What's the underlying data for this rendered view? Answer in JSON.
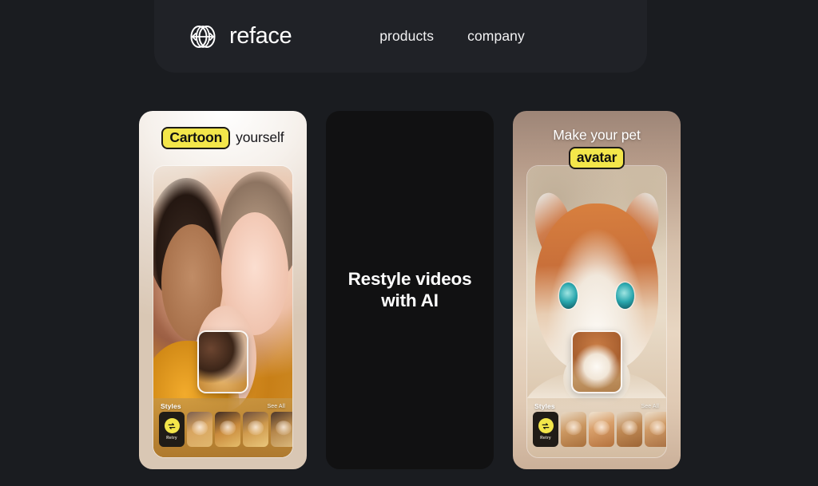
{
  "header": {
    "logo_icon": "reface-interlocking-circles-logo",
    "brand": "reface",
    "nav": [
      {
        "label": "products",
        "name": "nav-link-products"
      },
      {
        "label": "company",
        "name": "nav-link-company"
      }
    ]
  },
  "colors": {
    "page_background": "#1a1c20",
    "header_background": "#202227",
    "accent_yellow": "#f3e64a",
    "text_light": "#ffffff",
    "text_dark": "#17161a",
    "restyle_card_background": "#111112"
  },
  "cards": [
    {
      "name": "card-cartoon-yourself",
      "headline_badge": "Cartoon",
      "headline_plain": "yourself",
      "artwork": "cartoon-style-selfie-of-three-women",
      "preview_thumbnail": "original-photo-of-three-women-selfie",
      "tray": {
        "title": "Styles",
        "see_all": "See All",
        "retry_label": "Retry",
        "retry_icon": "swap-arrows-icon",
        "thumbnails": [
          "style-thumb-1",
          "style-thumb-2",
          "style-thumb-3",
          "style-thumb-4"
        ]
      }
    },
    {
      "name": "card-restyle-videos",
      "text": "Restyle videos\nwith AI",
      "text_line1": "Restyle videos",
      "text_line2": "with AI"
    },
    {
      "name": "card-pet-avatar",
      "headline_plain": "Make your pet",
      "headline_badge": "avatar",
      "artwork": "stylised-cartoon-dog-portrait",
      "preview_thumbnail": "original-photo-of-shiba-inu-dog",
      "tray": {
        "title": "Styles",
        "see_all": "See All",
        "retry_label": "Retry",
        "retry_icon": "swap-arrows-icon",
        "thumbnails": [
          "pet-style-thumb-1",
          "pet-style-thumb-2",
          "pet-style-thumb-3",
          "pet-style-thumb-4"
        ]
      }
    }
  ]
}
